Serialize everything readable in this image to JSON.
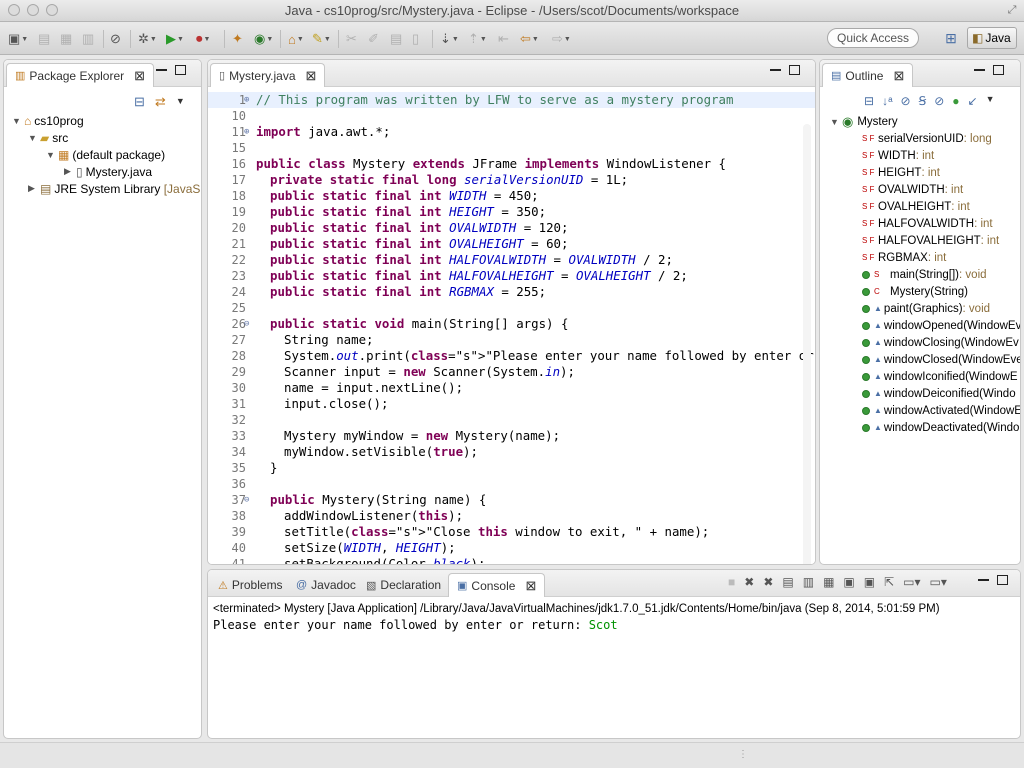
{
  "window": {
    "title": "Java - cs10prog/src/Mystery.java - Eclipse - /Users/scot/Documents/workspace"
  },
  "toolbar": {
    "quick_access": "Quick Access",
    "perspective": "Java"
  },
  "package_explorer": {
    "tab_label": "Package Explorer",
    "tree": [
      {
        "label": "cs10prog",
        "icon": "project-icon"
      },
      {
        "label": "src",
        "icon": "source-folder-icon"
      },
      {
        "label": "(default package)",
        "icon": "package-icon"
      },
      {
        "label": "Mystery.java",
        "icon": "java-file-icon"
      },
      {
        "label": "JRE System Library",
        "suffix": "[JavaSE-",
        "icon": "library-icon"
      }
    ]
  },
  "editor": {
    "tab_label": "Mystery.java",
    "lines": [
      {
        "n": "1",
        "fold": "+",
        "text": "// This program was written by LFW to serve as a mystery program",
        "type": "comment"
      },
      {
        "n": "10",
        "text": ""
      },
      {
        "n": "11",
        "fold": "+",
        "text": "import java.awt.*;",
        "type": "import"
      },
      {
        "n": "15",
        "text": ""
      },
      {
        "n": "16",
        "text": "public class Mystery extends JFrame implements WindowListener {",
        "type": "classdecl"
      },
      {
        "n": "17",
        "text": "private static final long serialVersionUID = 1L;",
        "type": "field",
        "name": "serialVersionUID",
        "ftype": "long",
        "value": "1L"
      },
      {
        "n": "18",
        "text": "public static final int WIDTH = 450;",
        "type": "field",
        "name": "WIDTH",
        "ftype": "int",
        "value": "450"
      },
      {
        "n": "19",
        "text": "public static final int HEIGHT = 350;",
        "type": "field",
        "name": "HEIGHT",
        "ftype": "int",
        "value": "350"
      },
      {
        "n": "20",
        "text": "public static final int OVALWIDTH = 120;",
        "type": "field",
        "name": "OVALWIDTH",
        "ftype": "int",
        "value": "120"
      },
      {
        "n": "21",
        "text": "public static final int OVALHEIGHT = 60;",
        "type": "field",
        "name": "OVALHEIGHT",
        "ftype": "int",
        "value": "60"
      },
      {
        "n": "22",
        "text": "public static final int HALFOVALWIDTH = OVALWIDTH / 2;",
        "type": "field"
      },
      {
        "n": "23",
        "text": "public static final int HALFOVALHEIGHT = OVALHEIGHT / 2;",
        "type": "field"
      },
      {
        "n": "24",
        "text": "public static final int RGBMAX = 255;",
        "type": "field"
      },
      {
        "n": "25",
        "text": ""
      },
      {
        "n": "26",
        "fold": "-",
        "text": "public static void main(String[] args) {",
        "type": "method"
      },
      {
        "n": "27",
        "text": "String name;"
      },
      {
        "n": "28",
        "text": "System.out.print(\"Please enter your name followed by enter or return: \");"
      },
      {
        "n": "29",
        "text": "Scanner input = new Scanner(System.in);"
      },
      {
        "n": "30",
        "text": "name = input.nextLine();"
      },
      {
        "n": "31",
        "text": "input.close();"
      },
      {
        "n": "32",
        "text": ""
      },
      {
        "n": "33",
        "text": "Mystery myWindow = new Mystery(name);"
      },
      {
        "n": "34",
        "text": "myWindow.setVisible(true);"
      },
      {
        "n": "35",
        "text": "}"
      },
      {
        "n": "36",
        "text": ""
      },
      {
        "n": "37",
        "fold": "-",
        "text": "public Mystery(String name) {"
      },
      {
        "n": "38",
        "text": "addWindowListener(this);"
      },
      {
        "n": "39",
        "text": "setTitle(\"Close this window to exit, \" + name);"
      },
      {
        "n": "40",
        "text": "setSize(WIDTH, HEIGHT);"
      },
      {
        "n": "41",
        "text": "setBackground(Color.black);"
      }
    ]
  },
  "outline": {
    "tab_label": "Outline",
    "root": "Mystery",
    "items": [
      {
        "label": "serialVersionUID",
        "type": " : long",
        "kind": "SF"
      },
      {
        "label": "WIDTH",
        "type": " : int",
        "kind": "SF"
      },
      {
        "label": "HEIGHT",
        "type": " : int",
        "kind": "SF"
      },
      {
        "label": "OVALWIDTH",
        "type": " : int",
        "kind": "SF"
      },
      {
        "label": "OVALHEIGHT",
        "type": " : int",
        "kind": "SF"
      },
      {
        "label": "HALFOVALWIDTH",
        "type": " : int",
        "kind": "SF"
      },
      {
        "label": "HALFOVALHEIGHT",
        "type": " : int",
        "kind": "SF"
      },
      {
        "label": "RGBMAX",
        "type": " : int",
        "kind": "SF"
      },
      {
        "label": "main(String[])",
        "type": " : void",
        "kind": "S"
      },
      {
        "label": "Mystery(String)",
        "type": "",
        "kind": "C"
      },
      {
        "label": "paint(Graphics)",
        "type": " : void",
        "kind": "M"
      },
      {
        "label": "windowOpened(WindowEv",
        "type": "",
        "kind": "M"
      },
      {
        "label": "windowClosing(WindowEv",
        "type": "",
        "kind": "M"
      },
      {
        "label": "windowClosed(WindowEve",
        "type": "",
        "kind": "M"
      },
      {
        "label": "windowIconified(WindowE",
        "type": "",
        "kind": "M"
      },
      {
        "label": "windowDeiconified(Windo",
        "type": "",
        "kind": "M"
      },
      {
        "label": "windowActivated(WindowE",
        "type": "",
        "kind": "M"
      },
      {
        "label": "windowDeactivated(Windo",
        "type": "",
        "kind": "M"
      }
    ]
  },
  "bottom_panel": {
    "tabs": [
      "Problems",
      "Javadoc",
      "Declaration",
      "Console"
    ],
    "active_tab": "Console",
    "terminated_line": "<terminated> Mystery [Java Application] /Library/Java/JavaVirtualMachines/jdk1.7.0_51.jdk/Contents/Home/bin/java (Sep 8, 2014, 5:01:59 PM)",
    "output_prompt": "Please enter your name followed by enter or return: ",
    "output_input": "Scot"
  },
  "colors": {
    "keyword": "#7f0055",
    "comment": "#3f7f5f",
    "string": "#2a00ff",
    "field": "#0000c0",
    "console_input": "#009100"
  }
}
